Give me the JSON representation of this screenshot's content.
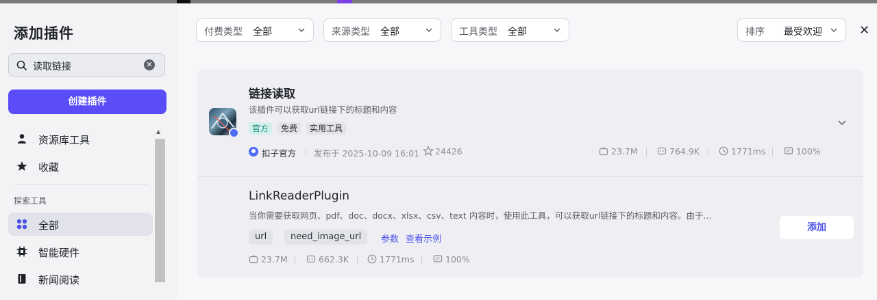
{
  "sidebar": {
    "title": "添加插件",
    "search": {
      "value": "读取链接",
      "icon": "search-icon",
      "clear_icon": "clear-icon"
    },
    "create_button": "创建插件",
    "items": [
      {
        "label": "资源库工具",
        "icon": "user-icon"
      },
      {
        "label": "收藏",
        "icon": "star-icon"
      }
    ],
    "section_label": "探索工具",
    "explore_items": [
      {
        "label": "全部",
        "icon": "grid-icon",
        "active": true
      },
      {
        "label": "智能硬件",
        "icon": "chip-icon"
      },
      {
        "label": "新闻阅读",
        "icon": "book-icon"
      }
    ]
  },
  "filters": [
    {
      "label": "付费类型",
      "value": "全部"
    },
    {
      "label": "来源类型",
      "value": "全部"
    },
    {
      "label": "工具类型",
      "value": "全部"
    }
  ],
  "sort": {
    "label": "排序",
    "value": "最受欢迎"
  },
  "plugin": {
    "title": "链接读取",
    "description": "该插件可以获取url链接下的标题和内容",
    "tags": [
      "官方",
      "免费",
      "实用工具"
    ],
    "author": "扣子官方",
    "published": "发布于 2025-10-09 16:01",
    "stars": "24426",
    "stats": {
      "bots": "23.7M",
      "calls": "764.9K",
      "latency": "1771ms",
      "success": "100%"
    }
  },
  "tool": {
    "title": "LinkReaderPlugin",
    "description": "当你需要获取网页、pdf、doc、docx、xlsx、csv、text 内容时，使用此工具，可以获取url链接下的标题和内容。由于…",
    "params": [
      "url",
      "need_image_url"
    ],
    "params_link": "参数",
    "example_link": "查看示例",
    "stats": {
      "bots": "23.7M",
      "calls": "662.3K",
      "latency": "1771ms",
      "success": "100%"
    },
    "add_button": "添加"
  },
  "colors": {
    "accent": "#5a4cf6",
    "link": "#4d53e8",
    "official_tag_bg": "#d3efeb"
  }
}
